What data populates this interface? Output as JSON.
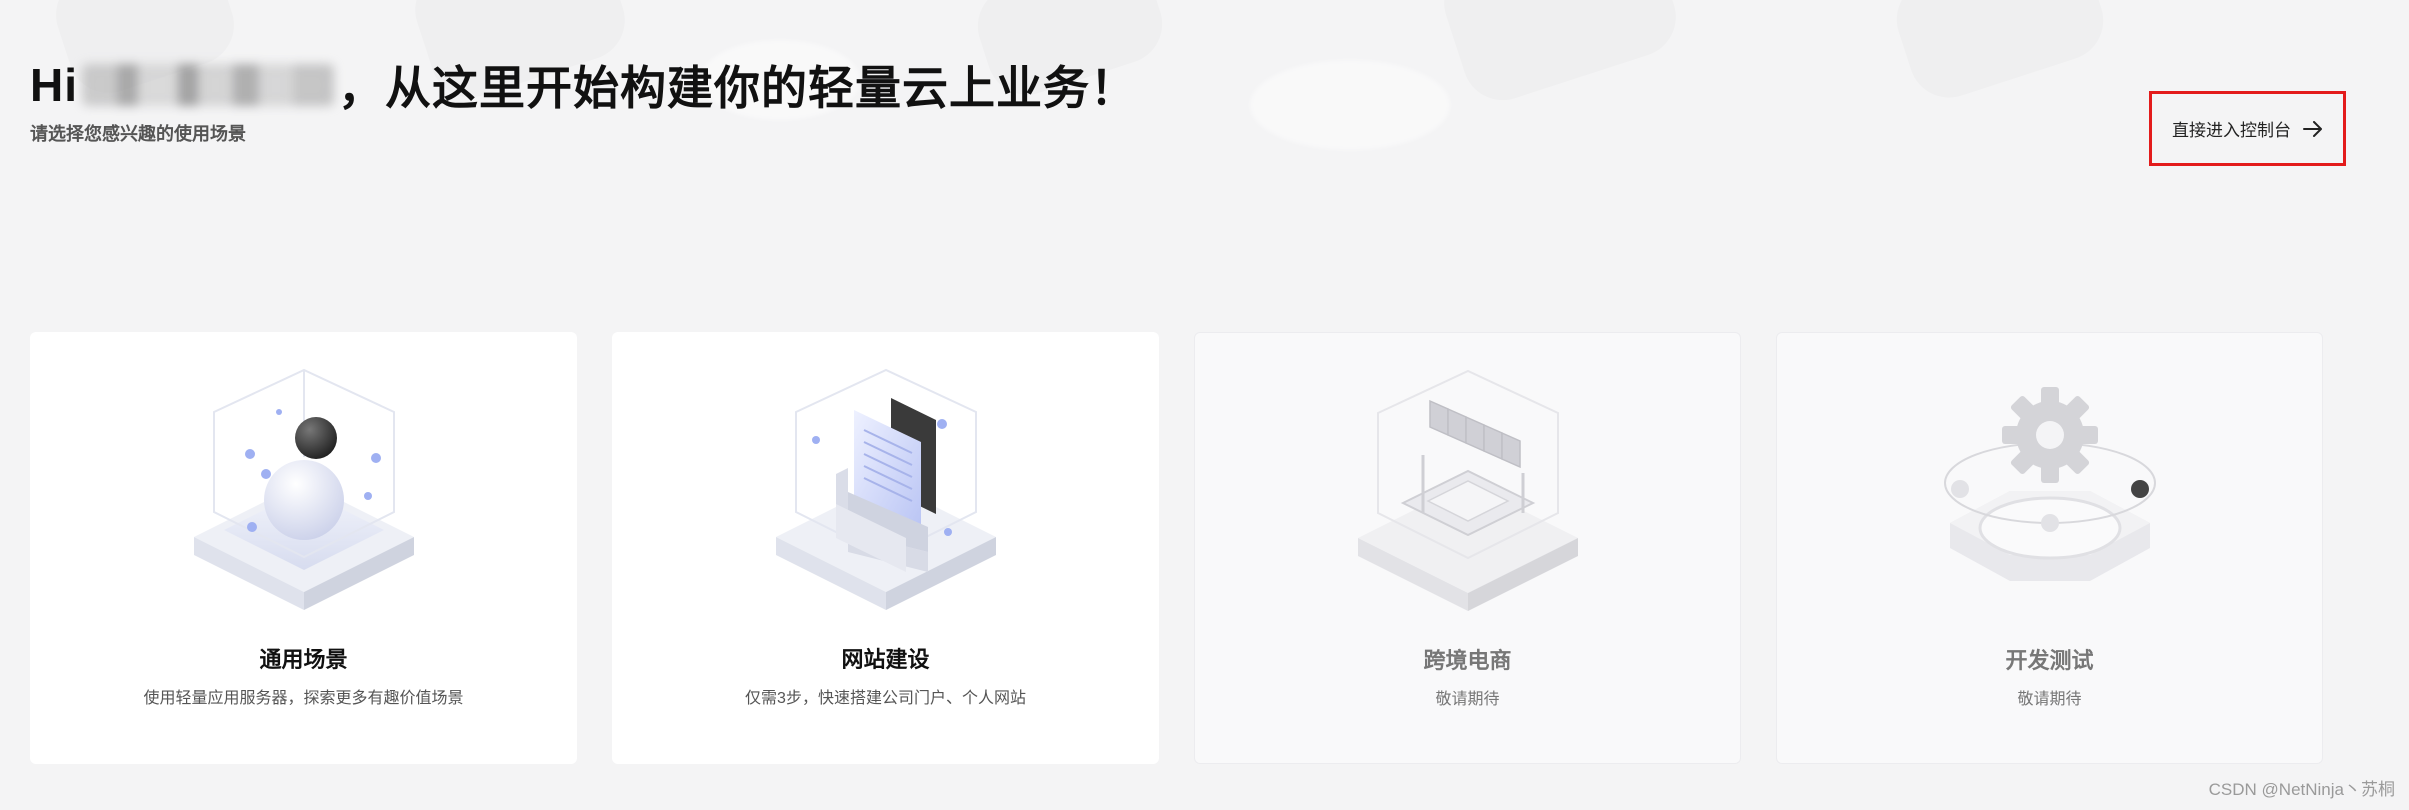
{
  "header": {
    "greeting_prefix": "Hi",
    "greeting_suffix": "，从这里开始构建你的轻量云上业务！",
    "subtitle": "请选择您感兴趣的使用场景"
  },
  "console_button": {
    "label": "直接进入控制台",
    "icon": "arrow-right-icon",
    "highlight_color": "#e31b1b"
  },
  "cards": [
    {
      "title": "通用场景",
      "description": "使用轻量应用服务器，探索更多有趣价值场景",
      "illustration": "sphere-cube-icon",
      "enabled": true
    },
    {
      "title": "网站建设",
      "description": "仅需3步，快速搭建公司门户、个人网站",
      "illustration": "document-box-icon",
      "enabled": true
    },
    {
      "title": "跨境电商",
      "description": "敬请期待",
      "illustration": "storefront-icon",
      "enabled": false
    },
    {
      "title": "开发测试",
      "description": "敬请期待",
      "illustration": "gear-orbit-icon",
      "enabled": false
    }
  ],
  "watermark": "CSDN @NetNinja丶苏桐",
  "colors": {
    "background": "#f4f4f5",
    "card": "#ffffff",
    "card_disabled": "#f9f9fa",
    "accent_blue": "#9aa8f0"
  }
}
